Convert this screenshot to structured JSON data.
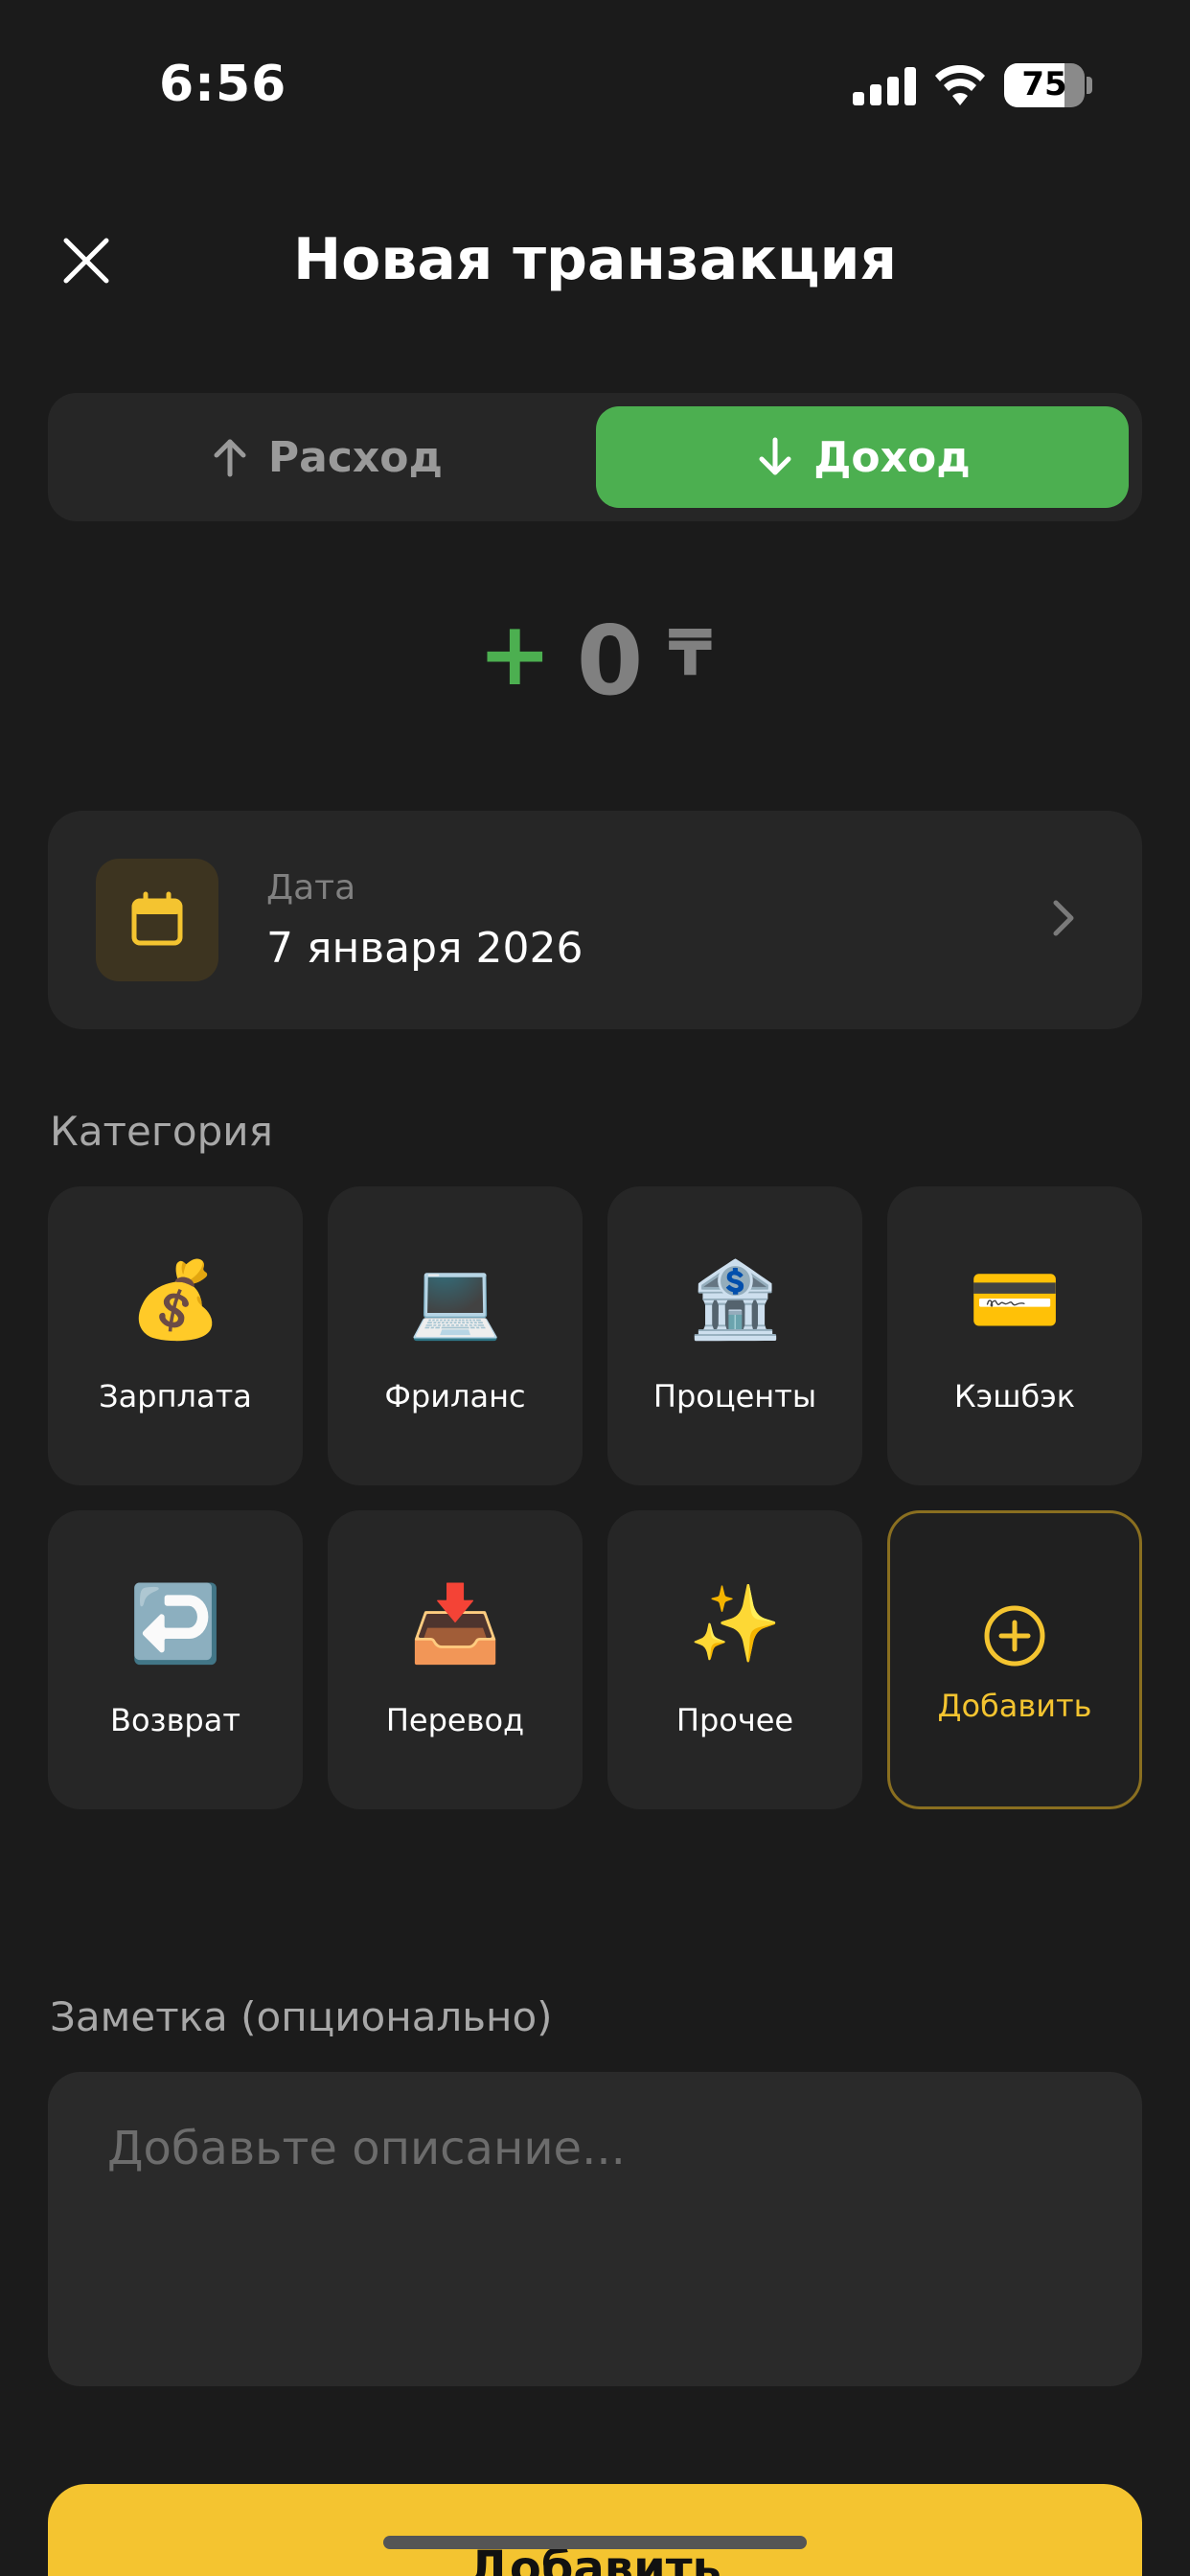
{
  "status_bar": {
    "time": "6:56",
    "battery": "75",
    "battery_level": 0.75
  },
  "header": {
    "title": "Новая транзакция"
  },
  "type_toggle": {
    "expense_label": "Расход",
    "income_label": "Доход",
    "selected": "income"
  },
  "amount": {
    "sign": "+",
    "value": "0",
    "currency": "₸"
  },
  "date": {
    "label": "Дата",
    "value": "7 января 2026"
  },
  "category": {
    "label": "Категория",
    "items": [
      {
        "emoji": "💰",
        "label": "Зарплата",
        "icon": "money-bag-icon"
      },
      {
        "emoji": "💻",
        "label": "Фриланс",
        "icon": "laptop-icon"
      },
      {
        "emoji": "🏦",
        "label": "Проценты",
        "icon": "bank-icon"
      },
      {
        "emoji": "💳",
        "label": "Кэшбэк",
        "icon": "credit-card-icon"
      },
      {
        "emoji": "↩️",
        "label": "Возврат",
        "icon": "return-arrow-icon"
      },
      {
        "emoji": "📥",
        "label": "Перевод",
        "icon": "inbox-tray-icon"
      },
      {
        "emoji": "✨",
        "label": "Прочее",
        "icon": "sparkles-icon"
      }
    ],
    "add_label": "Добавить"
  },
  "note": {
    "label": "Заметка (опционально)",
    "placeholder": "Добавьте описание..."
  },
  "submit": {
    "label": "Добавить"
  },
  "colors": {
    "background": "#1b1b1b",
    "card": "#262626",
    "income_green": "#4caf50",
    "accent_yellow": "#f4c430"
  }
}
